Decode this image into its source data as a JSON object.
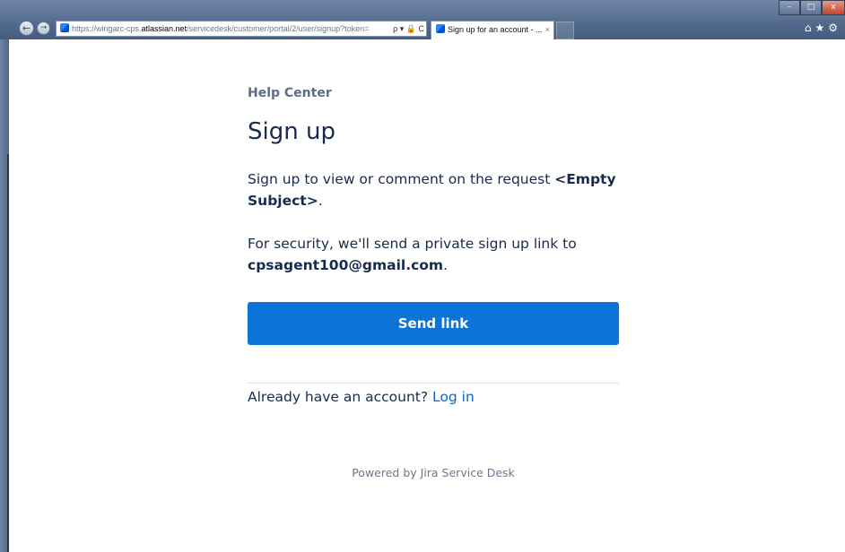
{
  "browser": {
    "address": {
      "scheme": "https://wingarc-cps.",
      "host": "atlassian.net",
      "rest": "/servicedesk/customer/portal/2/user/signup?token=",
      "icons": "ρ ▾ 🔒 C"
    },
    "tab": {
      "title": "Sign up for an account - ...",
      "close": "×"
    },
    "window_controls": {
      "minimize": "–",
      "maximize": "□",
      "close": "x"
    },
    "toolbar": {
      "home": "⌂",
      "favorites": "★",
      "settings": "⚙"
    },
    "back": "←",
    "forward": "→"
  },
  "page": {
    "help_center": "Help Center",
    "title": "Sign up",
    "p1_text": "Sign up to view or comment on the request ",
    "p1_bold": "<Empty Subject>",
    "p1_end": ".",
    "p2_text": "For security, we'll send a private sign up link to ",
    "p2_email": "cpsagent100@gmail.com",
    "p2_end": ".",
    "send_button": "Send link",
    "login_prompt": "Already have an account? ",
    "login_link": "Log in",
    "powered_by": "Powered by Jira Service Desk"
  },
  "colors": {
    "primary": "#0c73d9",
    "link": "#0c66c9",
    "text": "#172b4d",
    "muted": "#6b778c"
  }
}
